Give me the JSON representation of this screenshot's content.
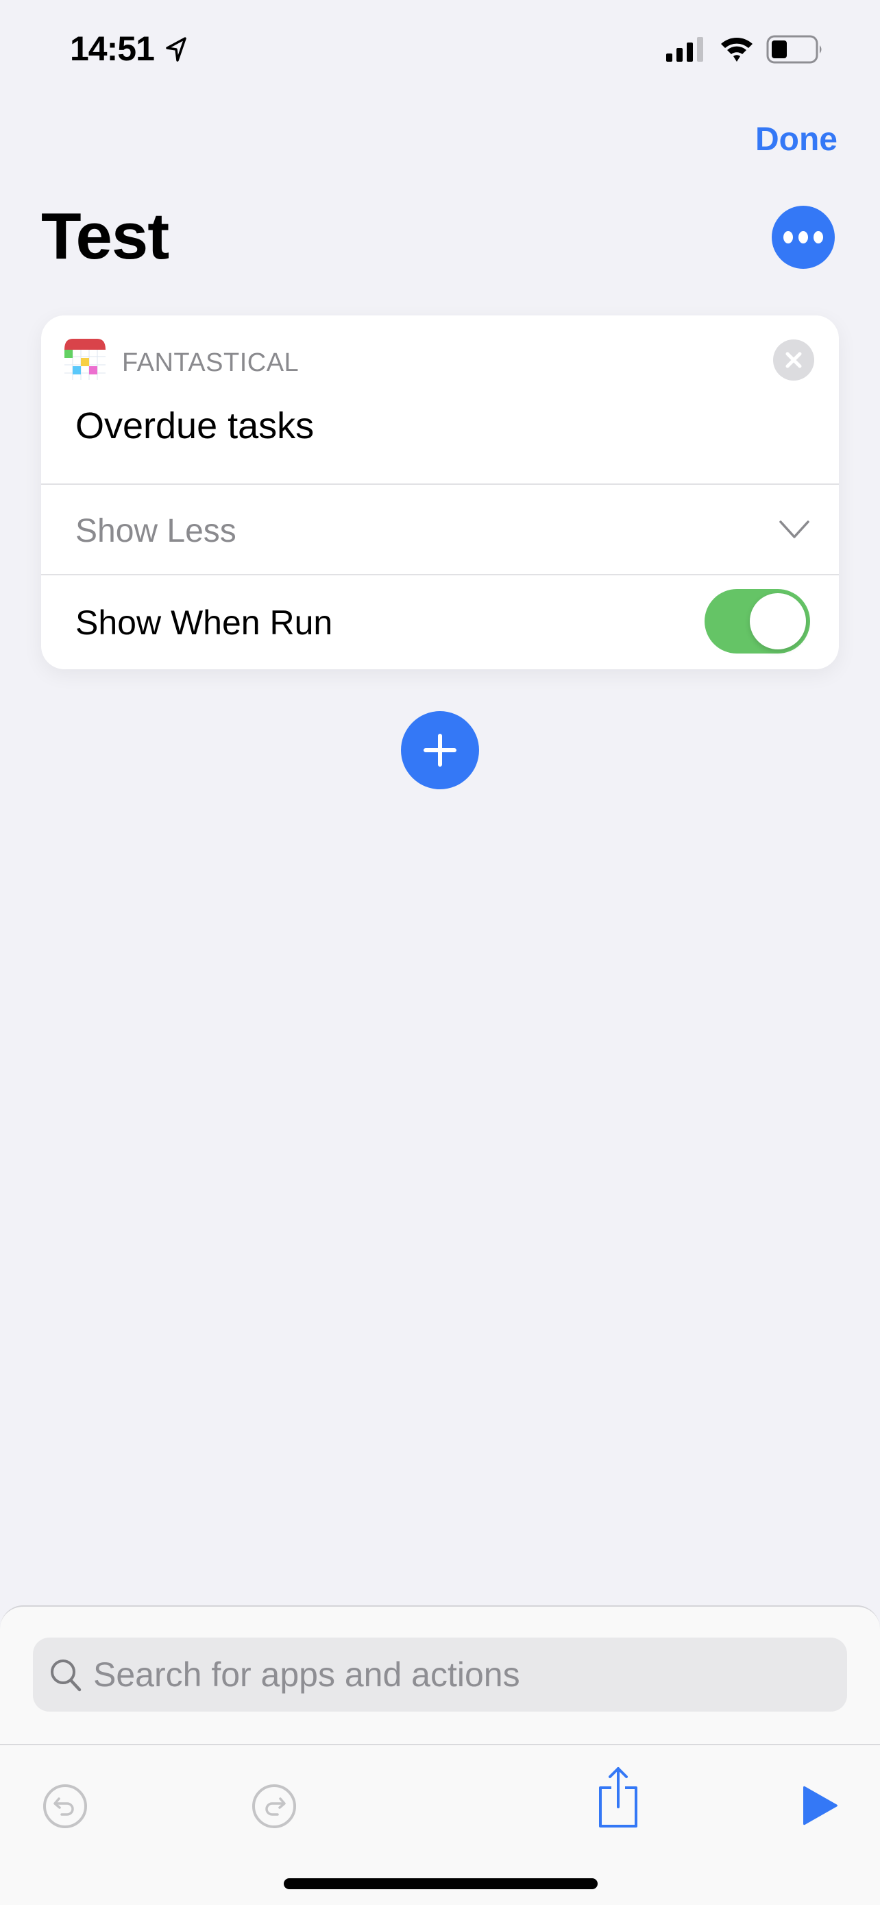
{
  "status_bar": {
    "time": "14:51",
    "icons": [
      "location-arrow-icon",
      "cellular-signal-icon",
      "wifi-icon",
      "battery-icon"
    ]
  },
  "nav": {
    "done_label": "Done",
    "title": "Test",
    "more_icon": "ellipsis-icon"
  },
  "action_card": {
    "app_name": "FANTASTICAL",
    "app_icon": "fantastical-app-icon",
    "title": "Overdue tasks",
    "close_icon": "close-icon",
    "show_less_label": "Show Less",
    "show_less_icon": "chevron-down-icon",
    "show_when_run_label": "Show When Run",
    "show_when_run_enabled": true
  },
  "add_action": {
    "icon": "plus-icon"
  },
  "bottom_sheet": {
    "search_placeholder": "Search for apps and actions",
    "search_value": "",
    "toolbar": {
      "undo_icon": "undo-icon",
      "redo_icon": "redo-icon",
      "share_icon": "share-icon",
      "run_icon": "play-icon"
    }
  },
  "colors": {
    "accent": "#3478f6",
    "toggle_on": "#65c466",
    "background": "#f2f2f7",
    "secondary_text": "#8a8a8e"
  }
}
